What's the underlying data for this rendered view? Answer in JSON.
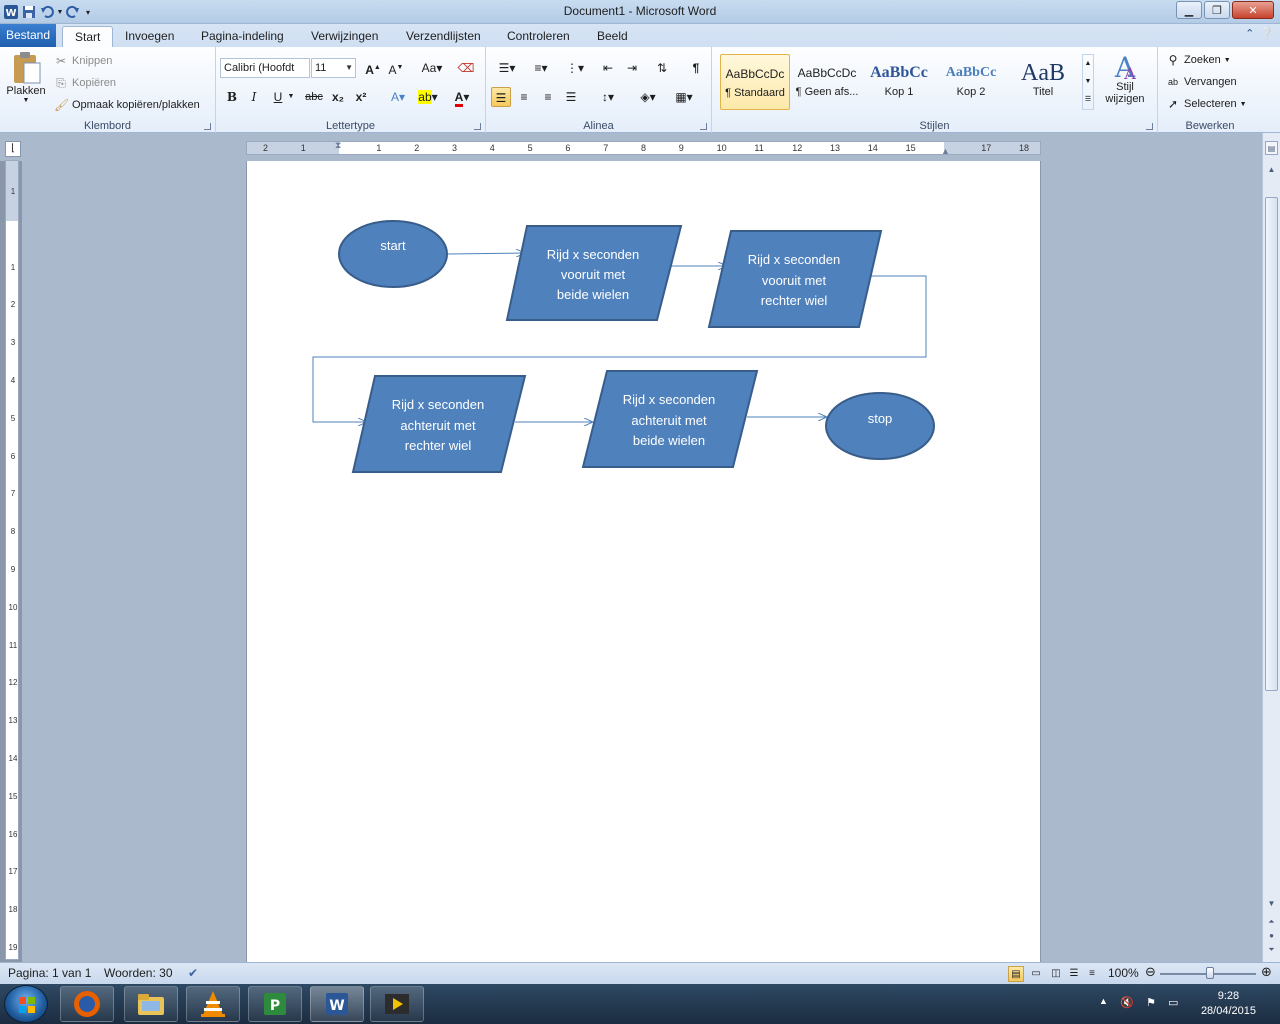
{
  "window": {
    "title": "Document1  -  Microsoft Word"
  },
  "tabs": [
    "Bestand",
    "Start",
    "Invoegen",
    "Pagina-indeling",
    "Verwijzingen",
    "Verzendlijsten",
    "Controleren",
    "Beeld"
  ],
  "clipboard": {
    "paste": "Plakken",
    "cut": "Knippen",
    "copy": "Kopiëren",
    "format_painter": "Opmaak kopiëren/plakken",
    "label": "Klembord"
  },
  "font": {
    "name": "Calibri (Hoofdt",
    "size": "11",
    "label": "Lettertype",
    "bold": "B",
    "italic": "I",
    "underline": "U",
    "strike": "abc",
    "subscript": "x₂",
    "superscript": "x²"
  },
  "paragraph": {
    "label": "Alinea",
    "pilcrow": "¶"
  },
  "styles": {
    "label": "Stijlen",
    "items": [
      {
        "sample": "AaBbCcDc",
        "name": "¶ Standaard"
      },
      {
        "sample": "AaBbCcDc",
        "name": "¶ Geen afs..."
      },
      {
        "sample": "AaBbCc",
        "name": "Kop 1"
      },
      {
        "sample": "AaBbCc",
        "name": "Kop 2"
      },
      {
        "sample": "AaB",
        "name": "Titel"
      }
    ],
    "change_style": "Stijl\nwijzigen"
  },
  "editing": {
    "label": "Bewerken",
    "find": "Zoeken",
    "replace": "Vervangen",
    "select": "Selecteren"
  },
  "ruler": {
    "h_numbers": [
      "2",
      "1",
      "",
      "1",
      "2",
      "3",
      "4",
      "5",
      "6",
      "7",
      "8",
      "9",
      "10",
      "11",
      "12",
      "13",
      "14",
      "15",
      "",
      "17",
      "18"
    ],
    "v_numbers": [
      "1",
      "",
      "1",
      "2",
      "3",
      "4",
      "5",
      "6",
      "7",
      "8",
      "9",
      "10",
      "11",
      "12",
      "13",
      "14",
      "15",
      "16",
      "17",
      "18",
      "19"
    ]
  },
  "flowchart": {
    "start": "start",
    "stop": "stop",
    "step1": [
      "Rijd x seconden",
      "vooruit met",
      "beide wielen"
    ],
    "step2": [
      "Rijd x seconden",
      "vooruit met",
      "rechter wiel"
    ],
    "step3": [
      "Rijd x seconden",
      "achteruit met",
      "rechter wiel"
    ],
    "step4": [
      "Rijd x seconden",
      "achteruit met",
      "beide wielen"
    ],
    "fill_color": "#4f81bd",
    "stroke_color": "#385d8a"
  },
  "status": {
    "page": "Pagina: 1 van 1",
    "words": "Woorden: 30",
    "zoom": "100%"
  },
  "clock": {
    "time": "9:28",
    "date": "28/04/2015"
  }
}
